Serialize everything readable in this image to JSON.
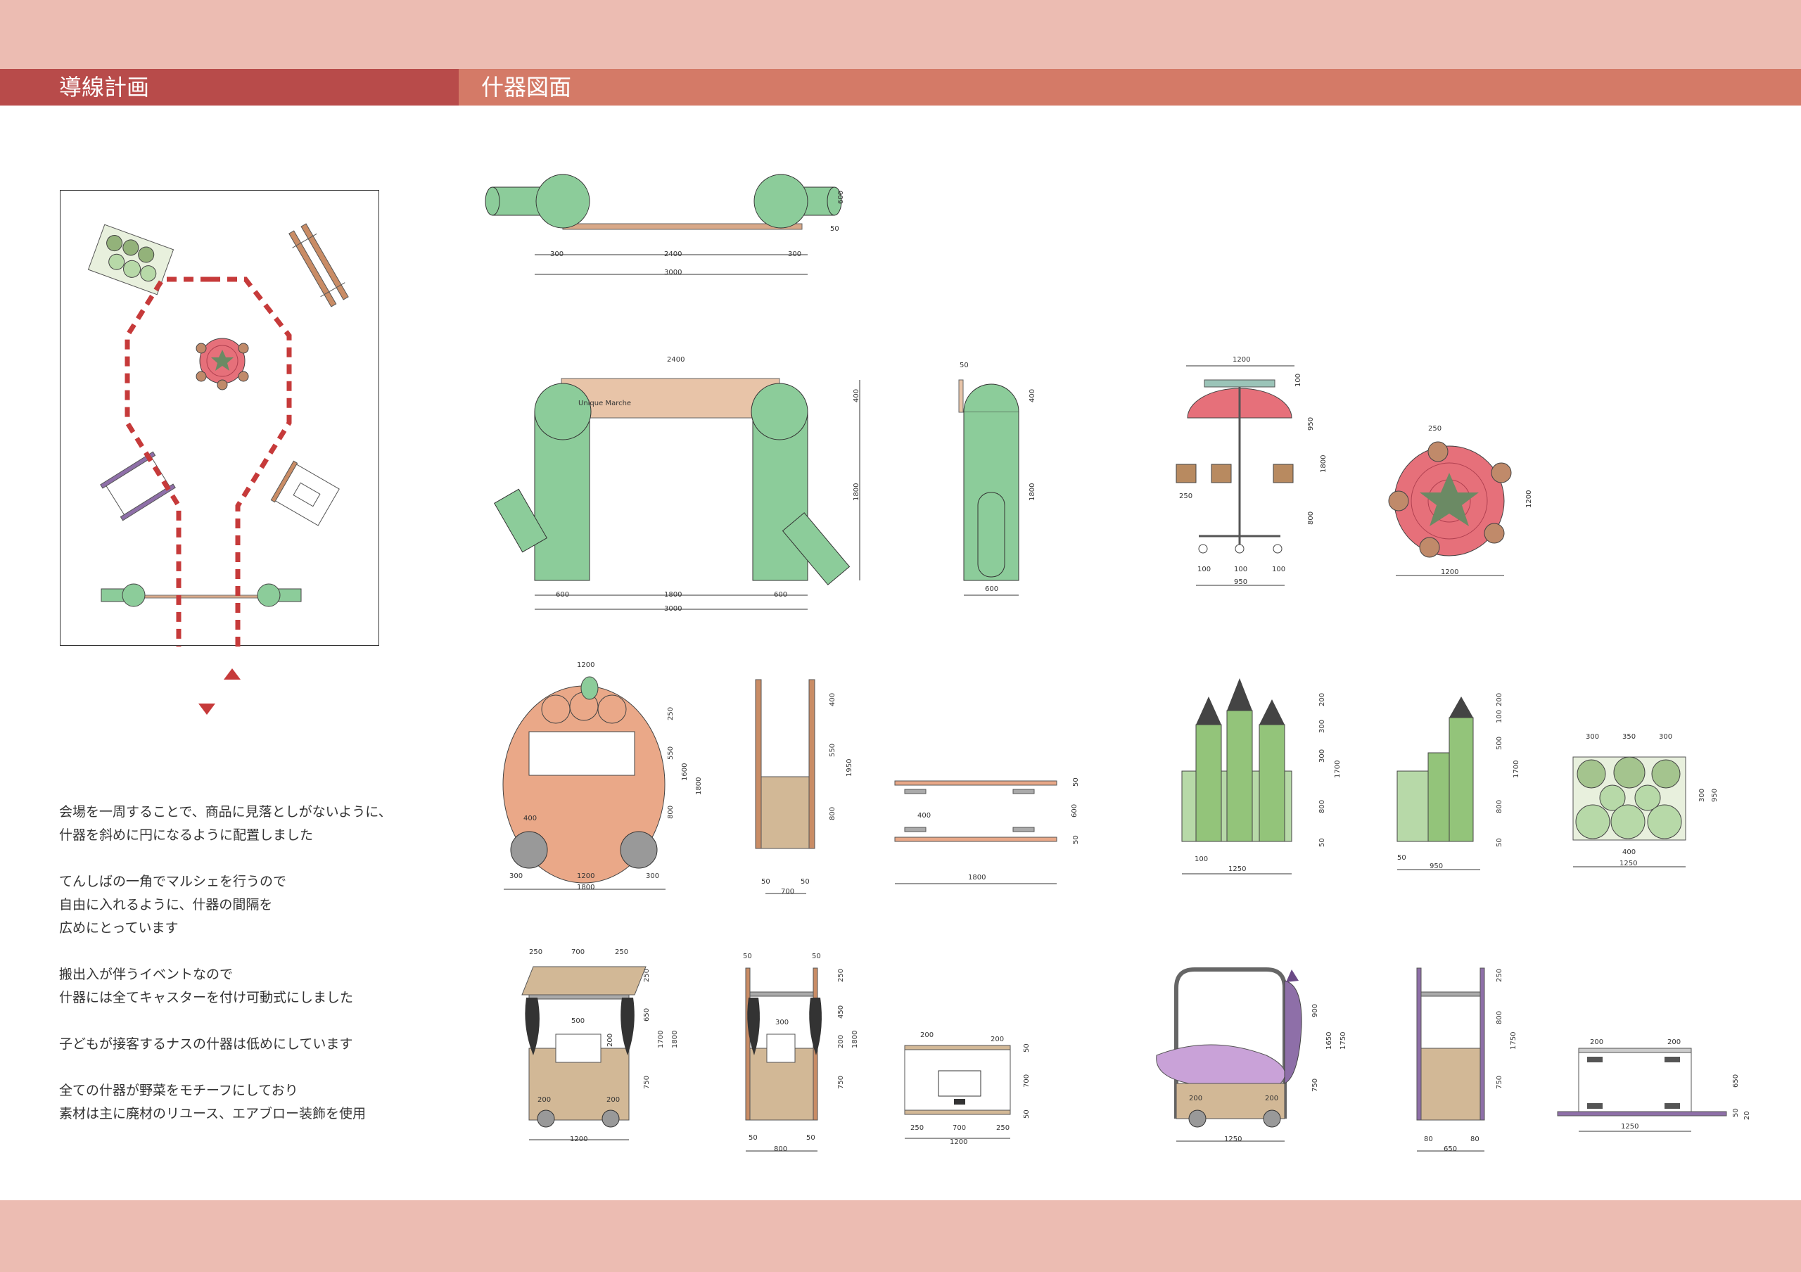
{
  "headers": {
    "left": "導線計画",
    "right": "什器図面"
  },
  "notes": [
    {
      "lines": [
        "会場を一周することで、商品に見落としがないように、",
        "什器を斜めに円になるように配置しました"
      ]
    },
    {
      "lines": [
        "てんしばの一角でマルシェを行うので",
        "自由に入れるように、什器の間隔を",
        "広めにとっています"
      ]
    },
    {
      "lines": [
        "搬出入が伴うイベントなので",
        "什器には全てキャスターを付け可動式にしました"
      ]
    },
    {
      "lines": [
        "子どもが接客するナスの什器は低めにしています"
      ]
    },
    {
      "lines": [
        "全ての什器が野菜をモチーフにしており",
        "素材は主に廃材のリユース、エアブロー装飾を使用"
      ]
    }
  ],
  "drawings": {
    "banner": {
      "d1": "300",
      "d2": "2400",
      "d3": "300",
      "total": "3000",
      "h": "600",
      "t": "50"
    },
    "gate": {
      "sign": "Unique Marche",
      "top": "2400",
      "w1": "600",
      "w2": "1800",
      "w3": "600",
      "total": "3000",
      "h1": "400",
      "h2": "1800"
    },
    "gate_side": {
      "t": "50",
      "h1": "400",
      "h2": "1800",
      "w": "600"
    },
    "umbrella": {
      "top": "1200",
      "d1": "100",
      "d2": "950",
      "d3": "1800",
      "d4": "800",
      "basket": "250",
      "b1": "100",
      "b2": "100",
      "b3": "100",
      "base": "950"
    },
    "umbrella_plan": {
      "basket": "250",
      "w": "1200",
      "h": "1200"
    },
    "pumpkin": {
      "top": "1200",
      "h1": "250",
      "h2": "1600",
      "h3": "1800",
      "h4": "550",
      "h5": "800",
      "w1": "300",
      "w2": "1200",
      "w3": "300",
      "total": "1800",
      "wheel": "400"
    },
    "pumpkin_side": {
      "h1": "400",
      "h2": "550",
      "h3": "1950",
      "h4": "800",
      "b1": "50",
      "b2": "50",
      "total": "700"
    },
    "pumpkin_plan": {
      "w": "400",
      "total": "1800",
      "h": "600",
      "t1": "50",
      "t2": "50"
    },
    "asparagus": {
      "h1": "200",
      "h2": "300",
      "h3": "300",
      "h4": "1700",
      "h5": "800",
      "h6": "50",
      "w1": "100",
      "total": "1250"
    },
    "asparagus_side": {
      "h1": "200",
      "h2": "100",
      "h3": "500",
      "h4": "1700",
      "h5": "800",
      "h6": "50",
      "w1": "50",
      "w2": "950"
    },
    "asparagus_plan": {
      "w1": "300",
      "w2": "350",
      "w3": "300",
      "h1": "300",
      "h2": "950",
      "mid": "400",
      "total": "1250"
    },
    "eggplant_stall": {
      "w1": "250",
      "w2": "700",
      "w3": "250",
      "h1": "250",
      "h2": "650",
      "h3": "1700",
      "h4": "1800",
      "h5": "750",
      "h6": "200",
      "mid": "500",
      "wh1": "200",
      "wh2": "200",
      "total": "1200"
    },
    "eggplant_side": {
      "t1": "50",
      "t2": "50",
      "h1": "250",
      "h2": "450",
      "h3": "200",
      "h4": "1800",
      "h5": "750",
      "mid": "300",
      "b1": "50",
      "b2": "50",
      "total": "800"
    },
    "eggplant_plan": {
      "w1": "200",
      "w2": "200",
      "w3": "250",
      "w4": "700",
      "w5": "250",
      "total": "1200",
      "h1": "50",
      "h2": "700",
      "h3": "50"
    },
    "nasu": {
      "h1": "900",
      "h2": "1650",
      "h3": "1750",
      "h4": "750",
      "wh1": "200",
      "wh2": "200",
      "total": "1250"
    },
    "nasu_side": {
      "h1": "250",
      "h2": "800",
      "h3": "1750",
      "h4": "750",
      "b1": "80",
      "b2": "80",
      "total": "650"
    },
    "nasu_plan": {
      "w1": "200",
      "w2": "200",
      "h": "650",
      "t1": "50",
      "t2": "20",
      "total": "1250"
    }
  }
}
